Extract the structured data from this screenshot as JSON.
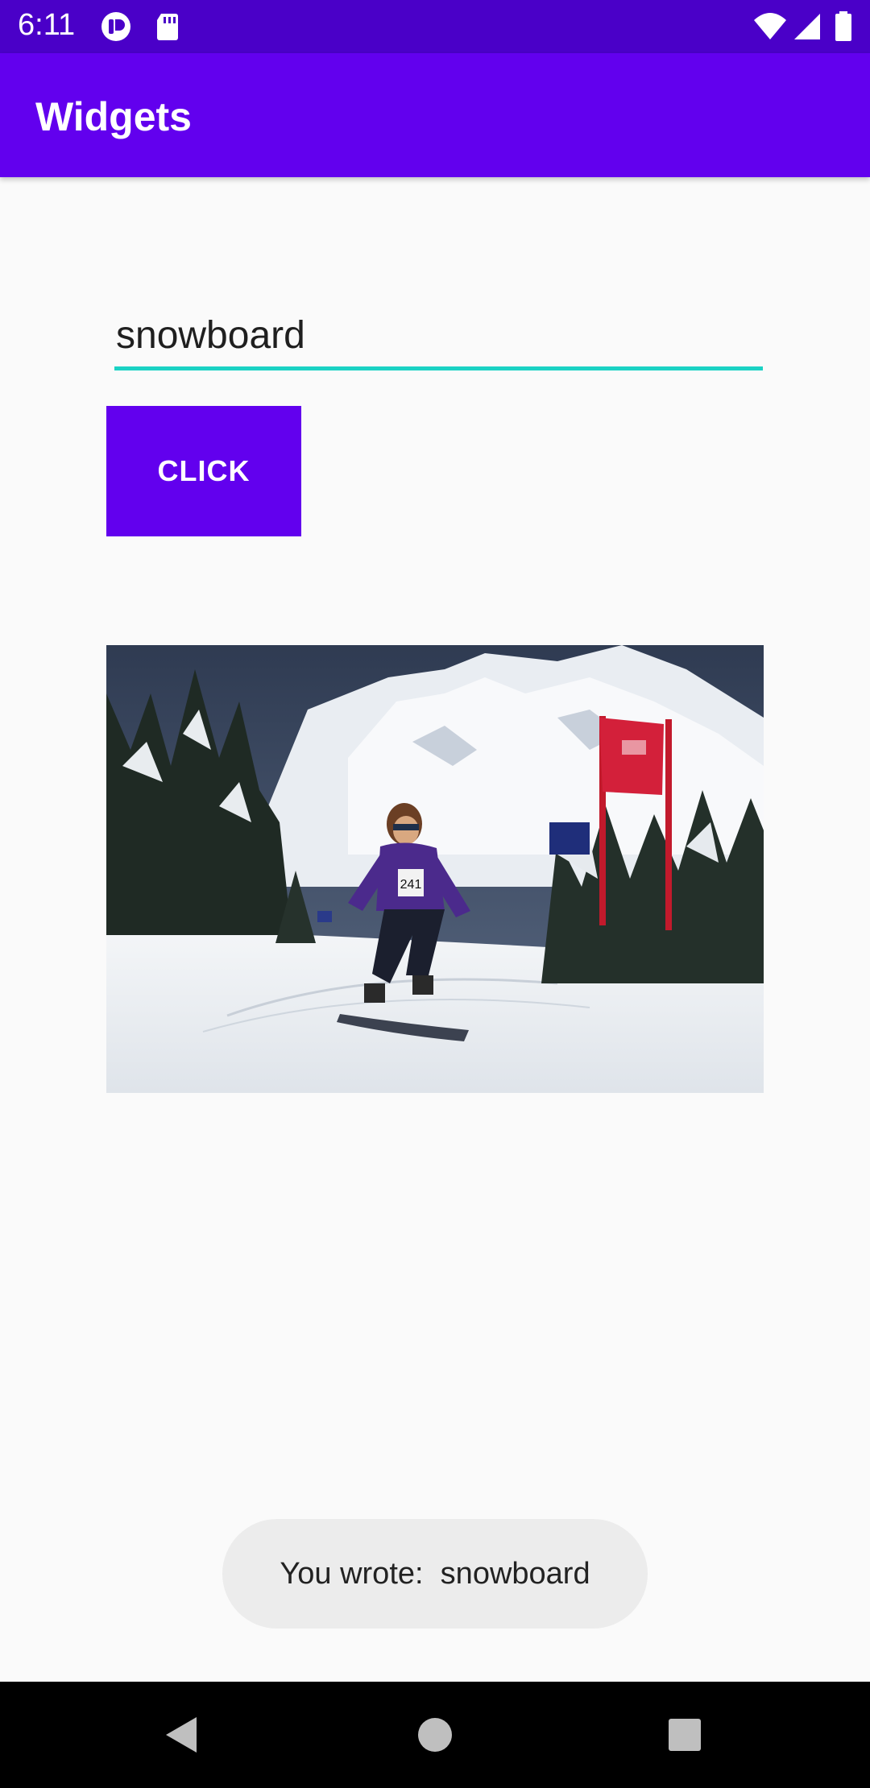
{
  "status_bar": {
    "time": "6:11",
    "left_icons": [
      "app-notification-icon",
      "sd-card-icon"
    ],
    "right_icons": [
      "wifi-icon",
      "cellular-signal-icon",
      "battery-icon"
    ]
  },
  "app_bar": {
    "title": "Widgets"
  },
  "form": {
    "input_value": "snowboard",
    "button_label": "CLICK"
  },
  "image": {
    "subject": "snowboarder racing past red slalom gate flag below a snowy mountain",
    "bib_number": "241"
  },
  "toast": {
    "message": "You wrote:  snowboard"
  },
  "nav_bar": {
    "buttons": [
      "back-icon",
      "home-icon",
      "recents-icon"
    ]
  },
  "colors": {
    "primary": "#6200ee",
    "primary_dark": "#4a00c8",
    "accent_underline": "#1ad2c4",
    "toast_background": "#ececec"
  }
}
